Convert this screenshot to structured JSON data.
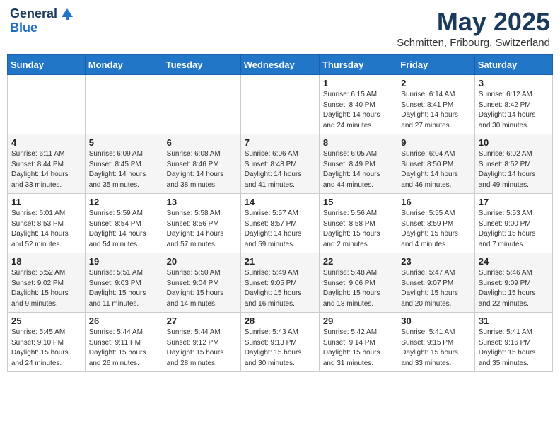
{
  "logo": {
    "general": "General",
    "blue": "Blue"
  },
  "title": "May 2025",
  "subtitle": "Schmitten, Fribourg, Switzerland",
  "days_of_week": [
    "Sunday",
    "Monday",
    "Tuesday",
    "Wednesday",
    "Thursday",
    "Friday",
    "Saturday"
  ],
  "weeks": [
    [
      {
        "day": "",
        "info": ""
      },
      {
        "day": "",
        "info": ""
      },
      {
        "day": "",
        "info": ""
      },
      {
        "day": "",
        "info": ""
      },
      {
        "day": "1",
        "info": "Sunrise: 6:15 AM\nSunset: 8:40 PM\nDaylight: 14 hours\nand 24 minutes."
      },
      {
        "day": "2",
        "info": "Sunrise: 6:14 AM\nSunset: 8:41 PM\nDaylight: 14 hours\nand 27 minutes."
      },
      {
        "day": "3",
        "info": "Sunrise: 6:12 AM\nSunset: 8:42 PM\nDaylight: 14 hours\nand 30 minutes."
      }
    ],
    [
      {
        "day": "4",
        "info": "Sunrise: 6:11 AM\nSunset: 8:44 PM\nDaylight: 14 hours\nand 33 minutes."
      },
      {
        "day": "5",
        "info": "Sunrise: 6:09 AM\nSunset: 8:45 PM\nDaylight: 14 hours\nand 35 minutes."
      },
      {
        "day": "6",
        "info": "Sunrise: 6:08 AM\nSunset: 8:46 PM\nDaylight: 14 hours\nand 38 minutes."
      },
      {
        "day": "7",
        "info": "Sunrise: 6:06 AM\nSunset: 8:48 PM\nDaylight: 14 hours\nand 41 minutes."
      },
      {
        "day": "8",
        "info": "Sunrise: 6:05 AM\nSunset: 8:49 PM\nDaylight: 14 hours\nand 44 minutes."
      },
      {
        "day": "9",
        "info": "Sunrise: 6:04 AM\nSunset: 8:50 PM\nDaylight: 14 hours\nand 46 minutes."
      },
      {
        "day": "10",
        "info": "Sunrise: 6:02 AM\nSunset: 8:52 PM\nDaylight: 14 hours\nand 49 minutes."
      }
    ],
    [
      {
        "day": "11",
        "info": "Sunrise: 6:01 AM\nSunset: 8:53 PM\nDaylight: 14 hours\nand 52 minutes."
      },
      {
        "day": "12",
        "info": "Sunrise: 5:59 AM\nSunset: 8:54 PM\nDaylight: 14 hours\nand 54 minutes."
      },
      {
        "day": "13",
        "info": "Sunrise: 5:58 AM\nSunset: 8:56 PM\nDaylight: 14 hours\nand 57 minutes."
      },
      {
        "day": "14",
        "info": "Sunrise: 5:57 AM\nSunset: 8:57 PM\nDaylight: 14 hours\nand 59 minutes."
      },
      {
        "day": "15",
        "info": "Sunrise: 5:56 AM\nSunset: 8:58 PM\nDaylight: 15 hours\nand 2 minutes."
      },
      {
        "day": "16",
        "info": "Sunrise: 5:55 AM\nSunset: 8:59 PM\nDaylight: 15 hours\nand 4 minutes."
      },
      {
        "day": "17",
        "info": "Sunrise: 5:53 AM\nSunset: 9:00 PM\nDaylight: 15 hours\nand 7 minutes."
      }
    ],
    [
      {
        "day": "18",
        "info": "Sunrise: 5:52 AM\nSunset: 9:02 PM\nDaylight: 15 hours\nand 9 minutes."
      },
      {
        "day": "19",
        "info": "Sunrise: 5:51 AM\nSunset: 9:03 PM\nDaylight: 15 hours\nand 11 minutes."
      },
      {
        "day": "20",
        "info": "Sunrise: 5:50 AM\nSunset: 9:04 PM\nDaylight: 15 hours\nand 14 minutes."
      },
      {
        "day": "21",
        "info": "Sunrise: 5:49 AM\nSunset: 9:05 PM\nDaylight: 15 hours\nand 16 minutes."
      },
      {
        "day": "22",
        "info": "Sunrise: 5:48 AM\nSunset: 9:06 PM\nDaylight: 15 hours\nand 18 minutes."
      },
      {
        "day": "23",
        "info": "Sunrise: 5:47 AM\nSunset: 9:07 PM\nDaylight: 15 hours\nand 20 minutes."
      },
      {
        "day": "24",
        "info": "Sunrise: 5:46 AM\nSunset: 9:09 PM\nDaylight: 15 hours\nand 22 minutes."
      }
    ],
    [
      {
        "day": "25",
        "info": "Sunrise: 5:45 AM\nSunset: 9:10 PM\nDaylight: 15 hours\nand 24 minutes."
      },
      {
        "day": "26",
        "info": "Sunrise: 5:44 AM\nSunset: 9:11 PM\nDaylight: 15 hours\nand 26 minutes."
      },
      {
        "day": "27",
        "info": "Sunrise: 5:44 AM\nSunset: 9:12 PM\nDaylight: 15 hours\nand 28 minutes."
      },
      {
        "day": "28",
        "info": "Sunrise: 5:43 AM\nSunset: 9:13 PM\nDaylight: 15 hours\nand 30 minutes."
      },
      {
        "day": "29",
        "info": "Sunrise: 5:42 AM\nSunset: 9:14 PM\nDaylight: 15 hours\nand 31 minutes."
      },
      {
        "day": "30",
        "info": "Sunrise: 5:41 AM\nSunset: 9:15 PM\nDaylight: 15 hours\nand 33 minutes."
      },
      {
        "day": "31",
        "info": "Sunrise: 5:41 AM\nSunset: 9:16 PM\nDaylight: 15 hours\nand 35 minutes."
      }
    ]
  ]
}
